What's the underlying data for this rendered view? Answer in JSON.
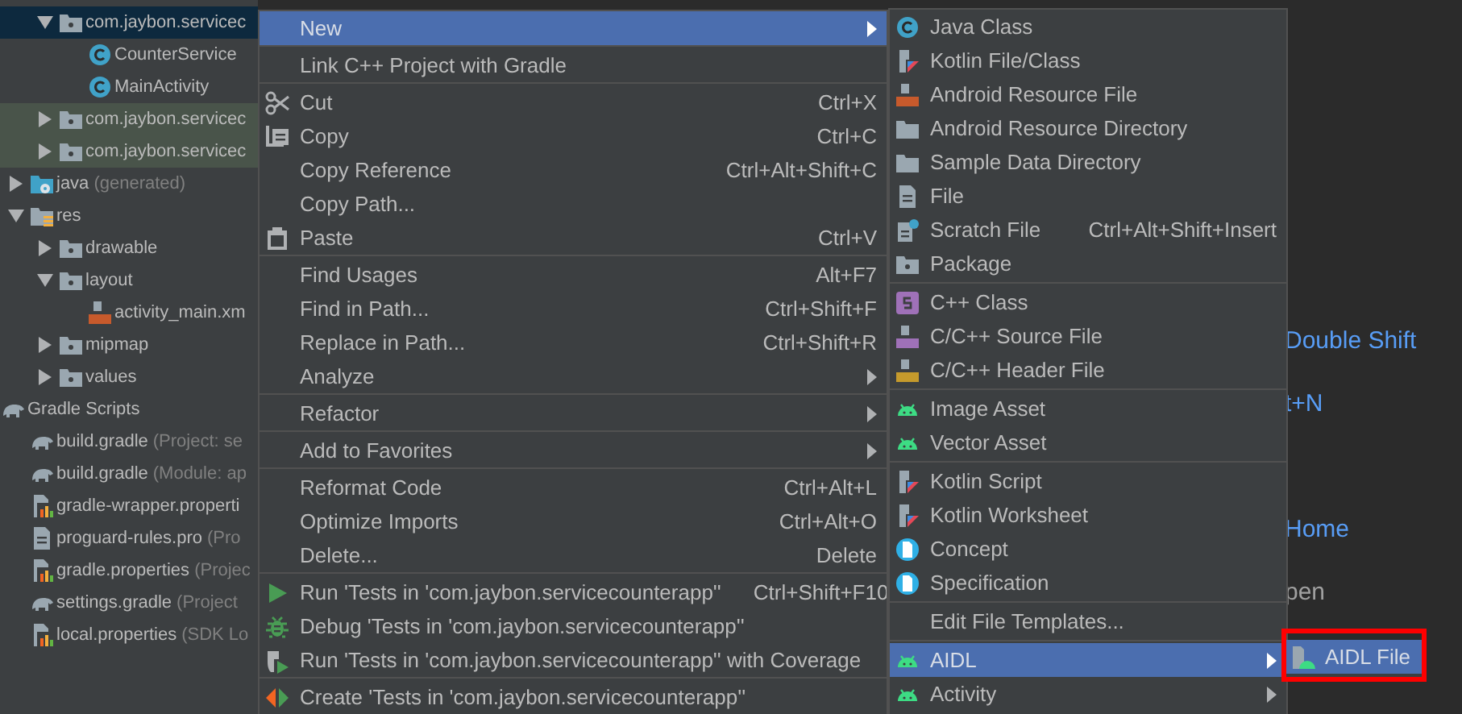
{
  "tree": [
    {
      "children": [
        {
          "children": [
            {
              "label": "com.jaybon.servicec",
              "kind": "package",
              "expanded": true,
              "selected": true,
              "children": [
                {
                  "label": "CounterService",
                  "kind": "class",
                  "selected": false
                },
                {
                  "label": "MainActivity",
                  "kind": "class",
                  "selected": false
                }
              ]
            },
            {
              "label": "com.jaybon.servicec",
              "kind": "test-package",
              "expanded": false,
              "selected": false
            },
            {
              "label": "com.jaybon.servicec",
              "kind": "test-package",
              "expanded": false,
              "selected": false
            }
          ]
        },
        {
          "label": "java",
          "detail": "(generated)",
          "kind": "source-folder",
          "expanded": false,
          "selected": false
        },
        {
          "label": "res",
          "kind": "res-folder",
          "expanded": true,
          "selected": false,
          "children": [
            {
              "label": "drawable",
              "kind": "package",
              "expanded": false,
              "selected": false
            },
            {
              "label": "layout",
              "kind": "package",
              "expanded": true,
              "selected": false,
              "children": [
                {
                  "label": "activity_main.xm",
                  "kind": "xml-file",
                  "selected": false
                }
              ]
            },
            {
              "label": "mipmap",
              "kind": "package",
              "expanded": false,
              "selected": false
            },
            {
              "label": "values",
              "kind": "package",
              "expanded": false,
              "selected": false
            }
          ]
        }
      ]
    },
    {
      "label": "Gradle Scripts",
      "kind": "gradle",
      "selected": false,
      "children": [
        {
          "label": "build.gradle",
          "detail": "(Project: se",
          "kind": "gradle",
          "selected": false
        },
        {
          "label": "build.gradle",
          "detail": "(Module: ap",
          "kind": "gradle",
          "selected": false
        },
        {
          "label": "gradle-wrapper.properti",
          "kind": "properties",
          "selected": false
        },
        {
          "label": "proguard-rules.pro",
          "detail": "(Pro",
          "kind": "text",
          "selected": false
        },
        {
          "label": "gradle.properties",
          "detail": "(Projec",
          "kind": "properties",
          "selected": false
        },
        {
          "label": "settings.gradle",
          "detail": "(Project",
          "kind": "gradle",
          "selected": false
        },
        {
          "label": "local.properties",
          "detail": "(SDK Lo",
          "kind": "properties",
          "selected": false
        }
      ]
    }
  ],
  "editor": {
    "hints": [
      {
        "text": "Double Shift",
        "kind": "link"
      },
      {
        "text": "t+N",
        "kind": "link"
      },
      {
        "text": "Home",
        "kind": "link"
      },
      {
        "text": "pen",
        "kind": "plain"
      }
    ]
  },
  "context_menu": {
    "groups": [
      [
        {
          "label": "New",
          "submenu": true,
          "selected": true
        }
      ],
      [
        {
          "label": "Link C++ Project with Gradle",
          "selected": false
        }
      ],
      [
        {
          "label": "Cut",
          "shortcut": "Ctrl+X",
          "kind": "scissors",
          "selected": false
        },
        {
          "label": "Copy",
          "shortcut": "Ctrl+C",
          "kind": "copy",
          "selected": false
        },
        {
          "label": "Copy Reference",
          "shortcut": "Ctrl+Alt+Shift+C",
          "selected": false
        },
        {
          "label": "Copy Path...",
          "selected": false
        },
        {
          "label": "Paste",
          "shortcut": "Ctrl+V",
          "kind": "paste",
          "selected": false
        }
      ],
      [
        {
          "label": "Find Usages",
          "shortcut": "Alt+F7",
          "selected": false
        },
        {
          "label": "Find in Path...",
          "shortcut": "Ctrl+Shift+F",
          "selected": false
        },
        {
          "label": "Replace in Path...",
          "shortcut": "Ctrl+Shift+R",
          "selected": false
        },
        {
          "label": "Analyze",
          "submenu": true,
          "selected": false
        }
      ],
      [
        {
          "label": "Refactor",
          "submenu": true,
          "selected": false
        }
      ],
      [
        {
          "label": "Add to Favorites",
          "submenu": true,
          "selected": false
        }
      ],
      [
        {
          "label": "Reformat Code",
          "shortcut": "Ctrl+Alt+L",
          "selected": false
        },
        {
          "label": "Optimize Imports",
          "shortcut": "Ctrl+Alt+O",
          "selected": false
        },
        {
          "label": "Delete...",
          "shortcut": "Delete",
          "selected": false
        }
      ],
      [
        {
          "label": "Run 'Tests in 'com.jaybon.servicecounterapp''",
          "shortcut": "Ctrl+Shift+F10",
          "kind": "run",
          "selected": false
        },
        {
          "label": "Debug 'Tests in 'com.jaybon.servicecounterapp''",
          "kind": "debug",
          "selected": false
        },
        {
          "label": "Run 'Tests in 'com.jaybon.servicecounterapp'' with Coverage",
          "kind": "coverage",
          "selected": false
        }
      ],
      [
        {
          "label": "Create 'Tests in 'com.jaybon.servicecounterapp''",
          "kind": "create",
          "selected": false
        }
      ]
    ]
  },
  "new_submenu": {
    "groups": [
      [
        {
          "label": "Java Class",
          "kind": "class",
          "selected": false
        },
        {
          "label": "Kotlin File/Class",
          "kind": "kotlin",
          "selected": false
        },
        {
          "label": "Android Resource File",
          "kind": "xml-file",
          "selected": false
        },
        {
          "label": "Android Resource Directory",
          "kind": "folder",
          "selected": false
        },
        {
          "label": "Sample Data Directory",
          "kind": "folder",
          "selected": false
        },
        {
          "label": "File",
          "kind": "text",
          "selected": false
        },
        {
          "label": "Scratch File",
          "shortcut": "Ctrl+Alt+Shift+Insert",
          "kind": "scratch",
          "selected": false
        },
        {
          "label": "Package",
          "kind": "package",
          "selected": false
        }
      ],
      [
        {
          "label": "C++ Class",
          "kind": "cpp-class",
          "selected": false
        },
        {
          "label": "C/C++ Source File",
          "kind": "cpp-source",
          "selected": false
        },
        {
          "label": "C/C++ Header File",
          "kind": "cpp-header",
          "selected": false
        }
      ],
      [
        {
          "label": "Image Asset",
          "kind": "android",
          "selected": false
        },
        {
          "label": "Vector Asset",
          "kind": "android",
          "selected": false
        }
      ],
      [
        {
          "label": "Kotlin Script",
          "kind": "kotlin",
          "selected": false
        },
        {
          "label": "Kotlin Worksheet",
          "kind": "kotlin",
          "selected": false
        },
        {
          "label": "Concept",
          "kind": "concept",
          "selected": false
        },
        {
          "label": "Specification",
          "kind": "concept",
          "selected": false
        }
      ],
      [
        {
          "label": "Edit File Templates...",
          "selected": false
        }
      ],
      [
        {
          "label": "AIDL",
          "submenu": true,
          "kind": "android",
          "selected": true
        },
        {
          "label": "Activity",
          "submenu": true,
          "kind": "android",
          "selected": false
        }
      ]
    ]
  },
  "aidl_submenu": {
    "groups": [
      [
        {
          "label": "AIDL File",
          "kind": "android-file",
          "selected": true
        }
      ]
    ]
  },
  "annotation": {
    "kind": "frame"
  }
}
